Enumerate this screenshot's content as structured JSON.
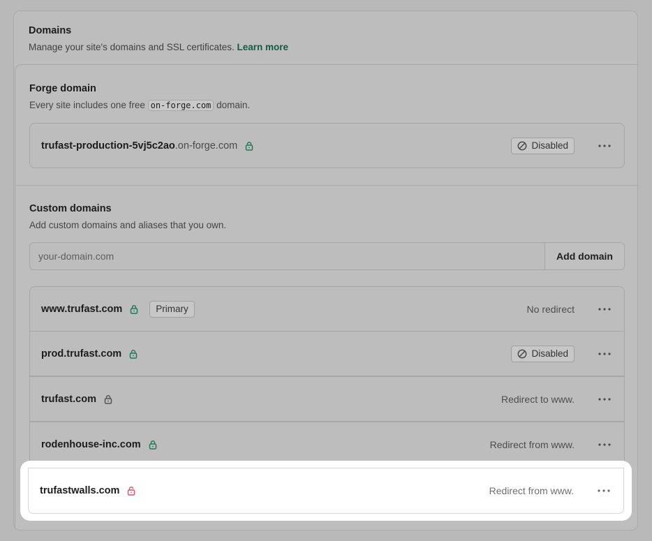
{
  "header": {
    "title": "Domains",
    "subtitle": "Manage your site's domains and SSL certificates.",
    "learn_more": "Learn more"
  },
  "forge": {
    "title": "Forge domain",
    "subtitle_pre": "Every site includes one free",
    "subtitle_code": "on-forge.com",
    "subtitle_post": "domain.",
    "domain_name": "trufast-production-5vj5c2ao",
    "domain_suffix": ".on-forge.com",
    "status": "Disabled"
  },
  "custom": {
    "title": "Custom domains",
    "subtitle": "Add custom domains and aliases that you own.",
    "input_placeholder": "your-domain.com",
    "add_button": "Add domain",
    "domains": [
      {
        "name": "www.trufast.com",
        "ssl": "green-lock-icon",
        "badge": "Primary",
        "status": "No redirect"
      },
      {
        "name": "prod.trufast.com",
        "ssl": "green-lock-icon",
        "status": "Disabled"
      },
      {
        "name": "trufast.com",
        "ssl": "gray-lock-icon",
        "status": "Redirect to www."
      },
      {
        "name": "rodenhouse-inc.com",
        "ssl": "green-lock-icon",
        "status": "Redirect from www."
      },
      {
        "name": "trufastwalls.com",
        "ssl": "red-unlock-icon",
        "status": "Redirect from www."
      }
    ]
  },
  "colors": {
    "accent_link": "#0c5f45",
    "lock_green": "#1f7a57",
    "lock_gray": "#555555",
    "lock_red": "#e0516a"
  }
}
